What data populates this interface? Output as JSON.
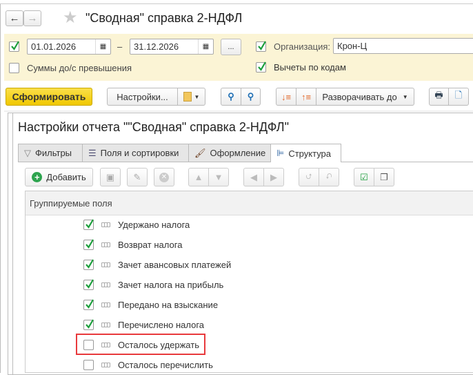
{
  "window": {
    "title": "\"Сводная\" справка 2-НДФЛ"
  },
  "filters": {
    "period_enabled": true,
    "date_from": "01.01.2026",
    "dash": "–",
    "date_to": "31.12.2026",
    "more_label": "...",
    "sums_label": "Суммы до/с превышения",
    "sums_checked": false,
    "org_checked": true,
    "org_label": "Организация:",
    "org_value": "Крон-Ц",
    "deductions_label": "Вычеты по кодам",
    "deductions_checked": true
  },
  "toolbar": {
    "generate": "Сформировать",
    "settings": "Настройки...",
    "expand": "Разворачивать до"
  },
  "settings": {
    "title": "Настройки отчета \"\"Сводная\" справка 2-НДФЛ\"",
    "tabs": [
      {
        "label": "Фильтры"
      },
      {
        "label": "Поля и сортировки"
      },
      {
        "label": "Оформление"
      },
      {
        "label": "Структура"
      }
    ],
    "add_label": "Добавить",
    "column_header": "Группируемые поля",
    "rows": [
      {
        "label": "Удержано налога",
        "checked": true
      },
      {
        "label": "Возврат налога",
        "checked": true
      },
      {
        "label": "Зачет авансовых платежей",
        "checked": true
      },
      {
        "label": "Зачет налога на прибыль",
        "checked": true
      },
      {
        "label": "Передано на взыскание",
        "checked": true
      },
      {
        "label": "Перечислено налога",
        "checked": true
      },
      {
        "label": "Осталось удержать",
        "checked": false,
        "highlighted": true
      },
      {
        "label": "Осталось перечислить",
        "checked": false
      }
    ]
  },
  "colors": {
    "accent": "#f5d31e",
    "filter_bg": "#fbf4d5",
    "check": "#1a9e3a",
    "highlight": "#e8393c"
  }
}
